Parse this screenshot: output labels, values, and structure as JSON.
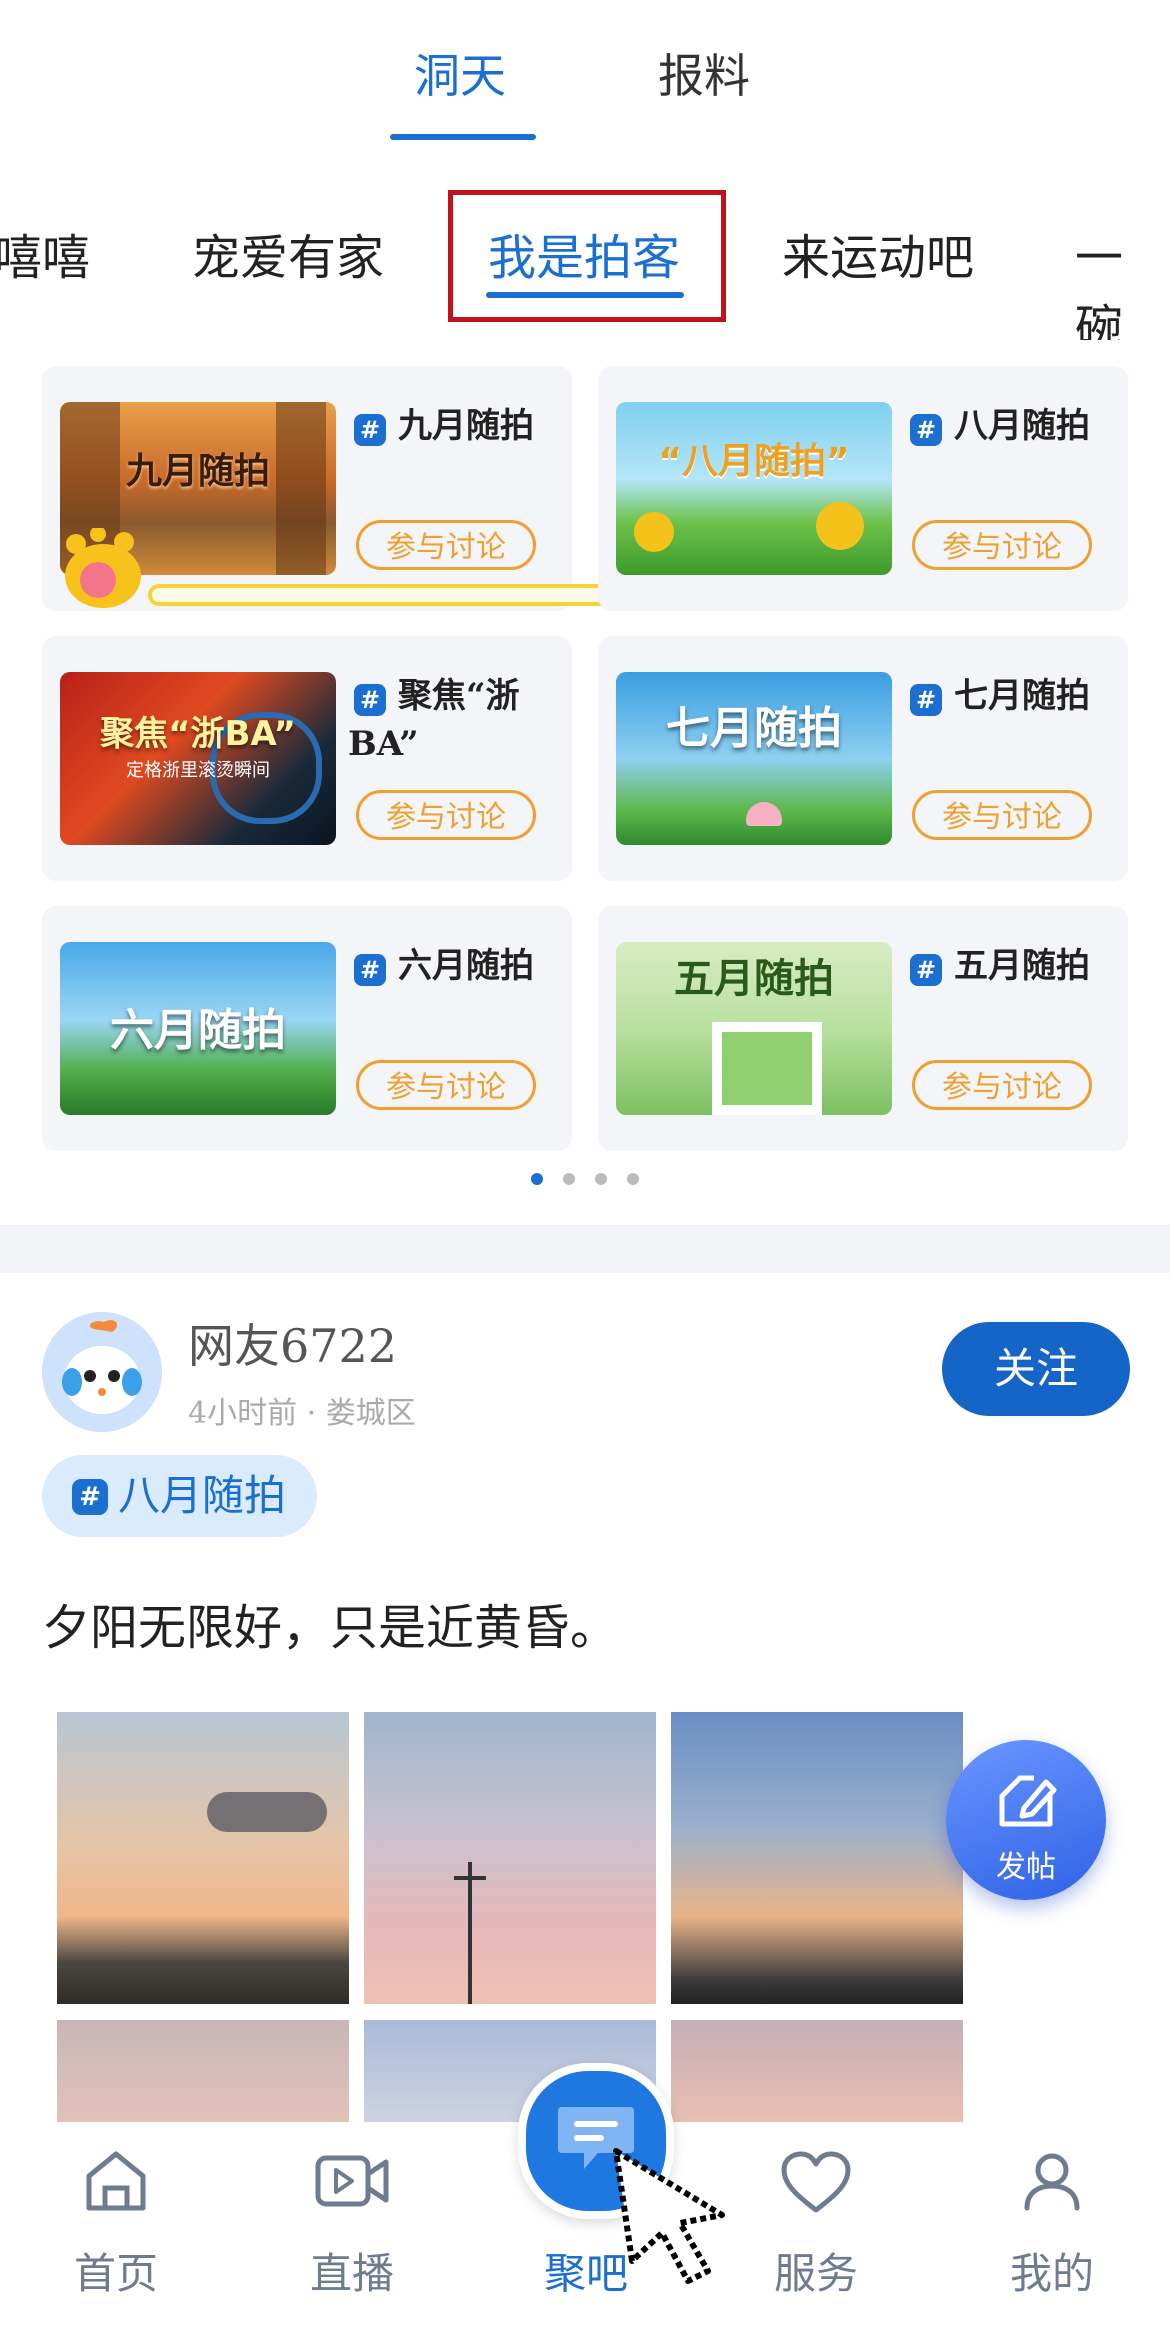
{
  "top_tabs": [
    {
      "label": "洞天",
      "active": true
    },
    {
      "label": "报料",
      "active": false
    }
  ],
  "categories": [
    {
      "label": "嘻嘻",
      "active": false
    },
    {
      "label": "宠爱有家",
      "active": false
    },
    {
      "label": "我是拍客",
      "active": true
    },
    {
      "label": "来运动吧",
      "active": false
    },
    {
      "label": "一碗",
      "active": false
    }
  ],
  "topics": [
    {
      "title": "九月随拍",
      "thumb_text": "九月随拍",
      "join": "参与讨论"
    },
    {
      "title": "八月随拍",
      "thumb_text": "“八月随拍”",
      "join": "参与讨论"
    },
    {
      "title": "聚焦“浙BA”",
      "thumb_text": "聚焦“浙BA”",
      "thumb_sub": "定格浙里滚烫瞬间",
      "join": "参与讨论"
    },
    {
      "title": "七月随拍",
      "thumb_text": "七月随拍",
      "join": "参与讨论"
    },
    {
      "title": "六月随拍",
      "thumb_text": "六月随拍",
      "join": "参与讨论"
    },
    {
      "title": "五月随拍",
      "thumb_text": "五月随拍",
      "join": "参与讨论"
    }
  ],
  "pager": {
    "count": 4,
    "active_index": 0
  },
  "post": {
    "username": "网友6722",
    "meta": "4小时前 · 娄城区",
    "follow_label": "关注",
    "topic_tag": "八月随拍",
    "text": "夕阳无限好，只是近黄昏。"
  },
  "fab_label": "发帖",
  "bottom_nav": [
    {
      "label": "首页",
      "icon": "home-icon",
      "active": false
    },
    {
      "label": "直播",
      "icon": "video-icon",
      "active": false
    },
    {
      "label": "聚吧",
      "icon": "chat-bubble-icon",
      "active": true
    },
    {
      "label": "服务",
      "icon": "heart-icon",
      "active": false
    },
    {
      "label": "我的",
      "icon": "user-icon",
      "active": false
    }
  ],
  "colors": {
    "accent": "#1a6fd1",
    "join_orange": "#f0a030",
    "highlight_box": "#c0121a",
    "progress_yellow": "#f7d33a"
  }
}
